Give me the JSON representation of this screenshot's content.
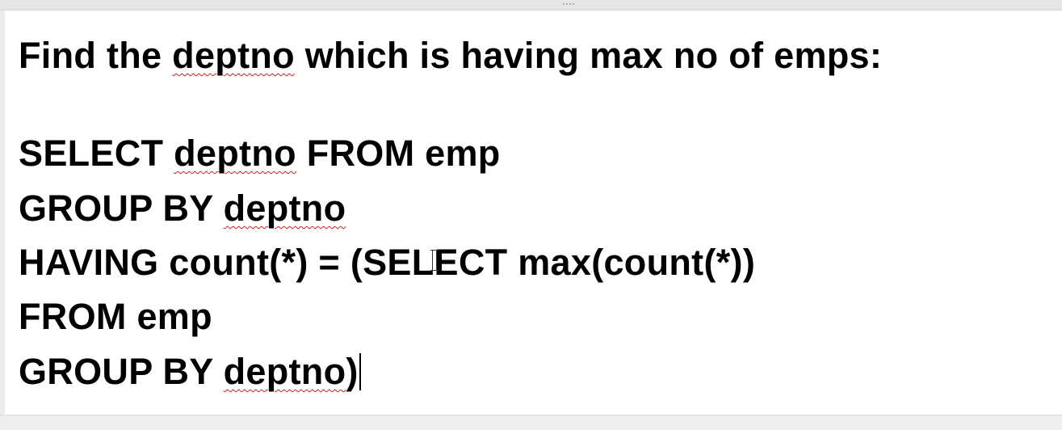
{
  "document": {
    "heading": {
      "before": "Find the ",
      "misspelled": "deptno",
      "after": " which is having max no of emps:"
    },
    "query": {
      "line1": {
        "before": "SELECT ",
        "misspelled": "deptno",
        "after": " FROM emp"
      },
      "line2": {
        "before": "GROUP BY ",
        "misspelled": "deptno"
      },
      "line3": {
        "before": "HAVING count(*) = (SEL",
        "after": "ECT max(count(*))"
      },
      "line4": {
        "text": "FROM emp"
      },
      "line5": {
        "before": "GROUP BY ",
        "misspelled": "deptno",
        "after": ")"
      }
    }
  }
}
